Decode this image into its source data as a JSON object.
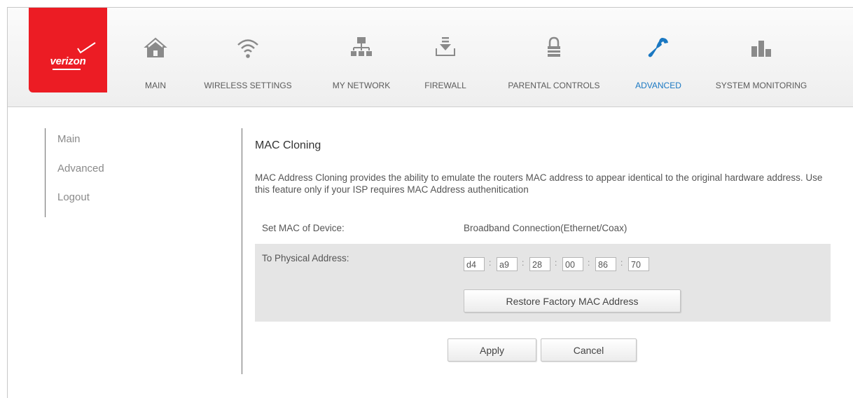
{
  "brand": {
    "name": "verizon",
    "color": "#ec1c24"
  },
  "nav": {
    "items": [
      {
        "label": "MAIN",
        "icon": "home-icon"
      },
      {
        "label": "WIRELESS SETTINGS",
        "icon": "wifi-icon"
      },
      {
        "label": "MY NETWORK",
        "icon": "network-icon"
      },
      {
        "label": "FIREWALL",
        "icon": "firewall-icon"
      },
      {
        "label": "PARENTAL CONTROLS",
        "icon": "lock-icon"
      },
      {
        "label": "ADVANCED",
        "icon": "wrench-icon",
        "active": true
      },
      {
        "label": "SYSTEM MONITORING",
        "icon": "bar-chart-icon"
      }
    ],
    "active_color": "#1a78c2"
  },
  "sidebar": {
    "items": [
      {
        "label": "Main"
      },
      {
        "label": "Advanced"
      },
      {
        "label": "Logout"
      }
    ]
  },
  "content": {
    "title": "MAC Cloning",
    "description": "MAC Address Cloning provides the ability to emulate the routers MAC address to appear identical to the original hardware address. Use this feature only if your ISP requires MAC Address authenitication",
    "set_mac_label": "Set MAC of Device:",
    "set_mac_value": "Broadband Connection(Ethernet/Coax)",
    "physical_label": "To Physical Address:",
    "mac_octets": [
      "d4",
      "a9",
      "28",
      "00",
      "86",
      "70"
    ],
    "separator": ":",
    "restore_button": "Restore Factory MAC Address",
    "apply_button": "Apply",
    "cancel_button": "Cancel"
  }
}
